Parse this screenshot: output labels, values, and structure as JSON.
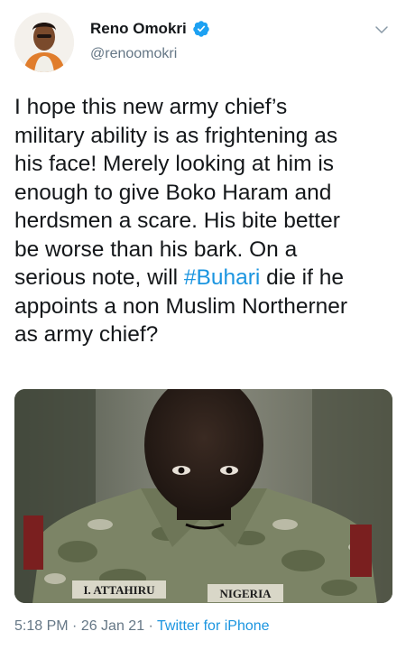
{
  "user": {
    "name": "Reno Omokri",
    "handle": "@renoomokri",
    "verified": true
  },
  "tweet": {
    "text_before": "I hope this new army chief’s\nmilitary ability is as frightening as\nhis face! Merely looking at him is\nenough to give Boko Haram and\nherdsmen a scare. His bite better\nbe worse than his bark. On a\nserious note, will ",
    "hashtag": "#Buhari",
    "text_after": " die if he\nappoints a non Muslim Northerner\nas army chief?"
  },
  "media": {
    "name_tag": "I. ATTAHIRU",
    "flag_tag": "NIGERIA"
  },
  "meta": {
    "time": "5:18 PM",
    "sep1": " · ",
    "date": "26 Jan 21",
    "sep2": " · ",
    "source": "Twitter for iPhone"
  },
  "colors": {
    "link": "#1b95e0",
    "secondary": "#657786",
    "verified": "#1da1f2"
  }
}
